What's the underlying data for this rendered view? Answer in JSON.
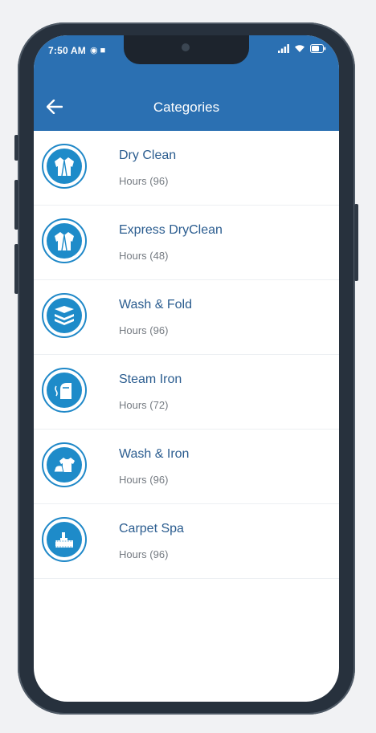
{
  "status_bar": {
    "time": "7:50 AM",
    "icons": [
      "alarm-icon",
      "video-icon",
      "signal-icon",
      "wifi-icon",
      "battery-icon"
    ]
  },
  "header": {
    "title": "Categories",
    "back_icon": "arrow-left-icon"
  },
  "colors": {
    "accent": "#2b70b2",
    "icon_blue": "#1e8bc9",
    "title_text": "#2a5c8f",
    "secondary_text": "#757b82"
  },
  "categories": [
    {
      "name": "Dry Clean",
      "hours": "Hours (96)",
      "icon": "jacket-icon"
    },
    {
      "name": "Express DryClean",
      "hours": "Hours (48)",
      "icon": "jacket-icon"
    },
    {
      "name": "Wash & Fold",
      "hours": "Hours (96)",
      "icon": "folded-clothes-icon"
    },
    {
      "name": "Steam Iron",
      "hours": "Hours (72)",
      "icon": "steam-iron-icon"
    },
    {
      "name": "Wash & Iron",
      "hours": "Hours (96)",
      "icon": "iron-tshirt-icon"
    },
    {
      "name": "Carpet Spa",
      "hours": "Hours (96)",
      "icon": "carpet-icon"
    }
  ]
}
